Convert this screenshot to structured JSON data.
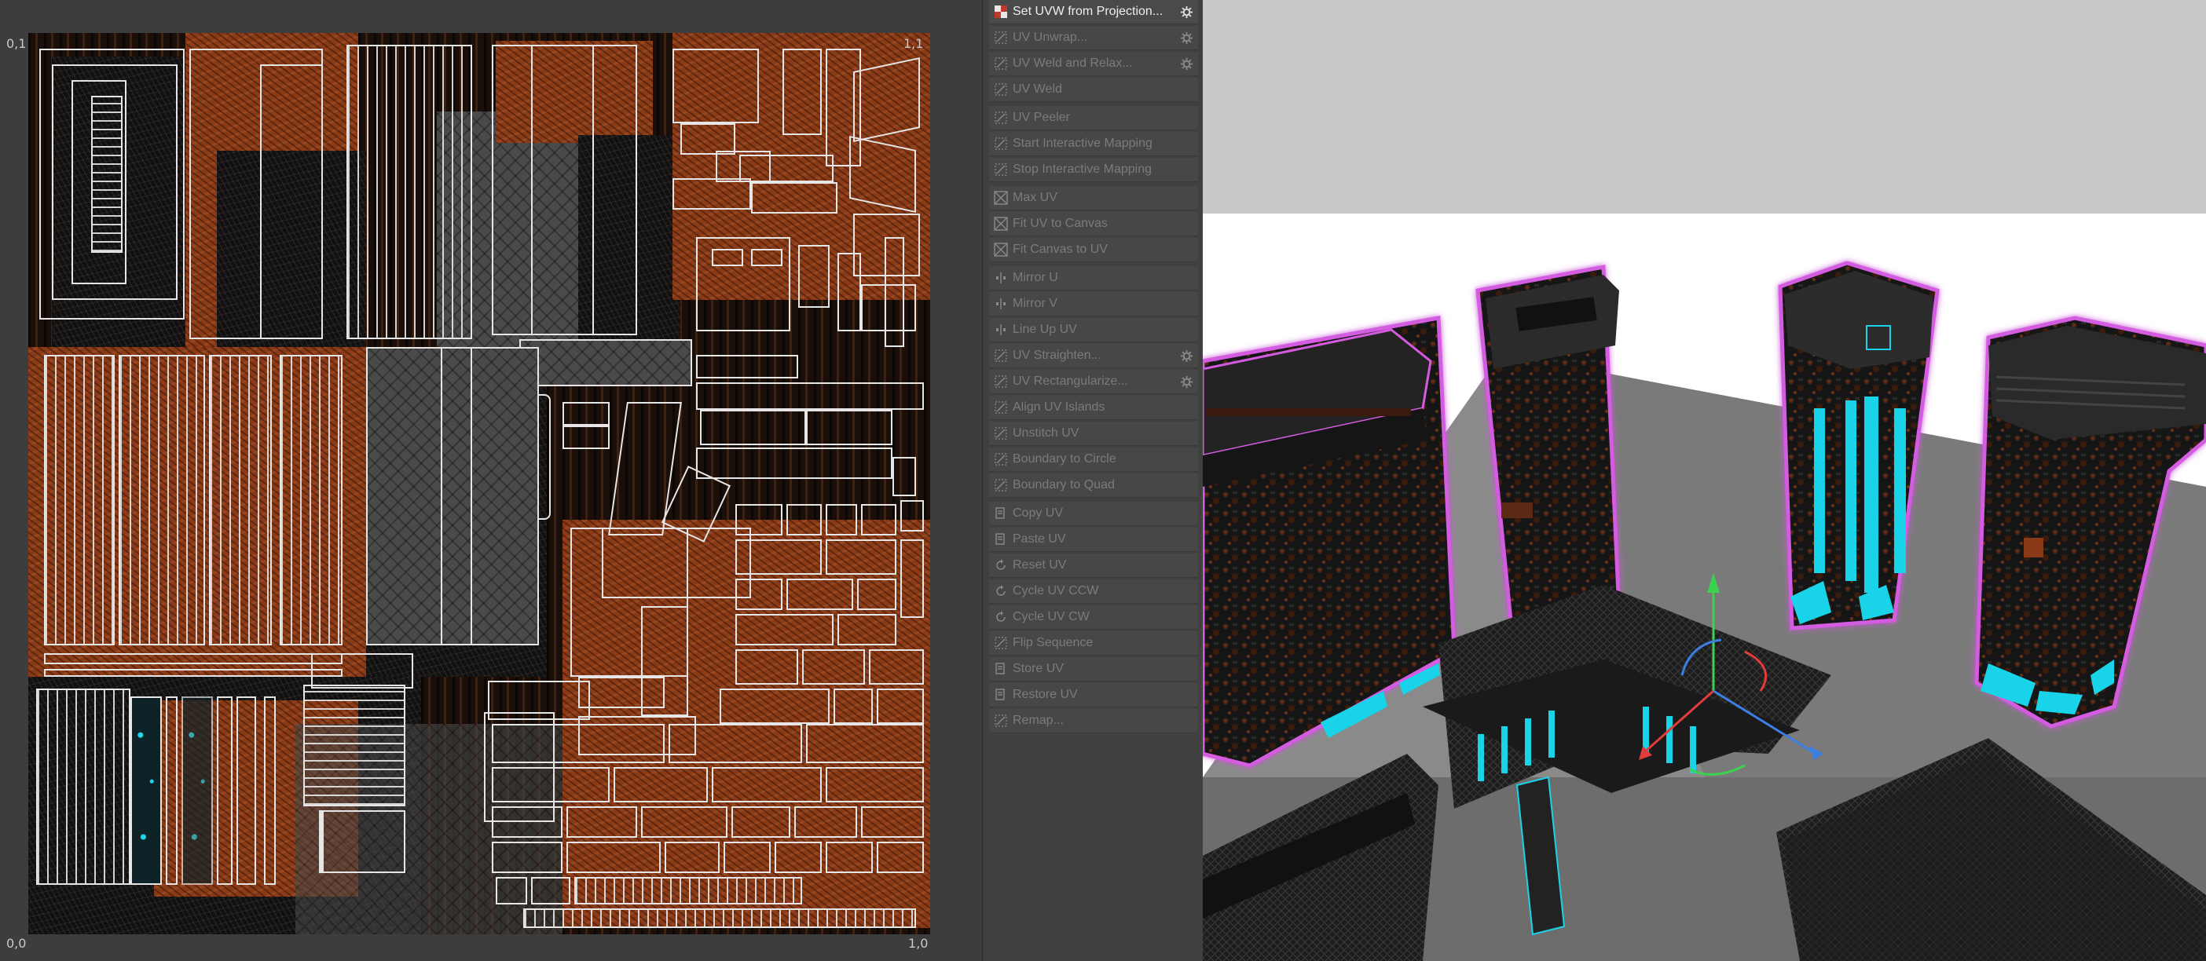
{
  "uv_editor": {
    "coords": {
      "top_left": "0,1",
      "top_right": "1,1",
      "bottom_left": "0,0",
      "bottom_right": "1,0"
    }
  },
  "menu": {
    "items": [
      {
        "label": "Set UVW from Projection...",
        "icon": "checker-icon",
        "active": true,
        "options": true
      },
      {
        "label": "UV Unwrap...",
        "icon": "unwrap-icon",
        "options": true
      },
      {
        "label": "UV Weld and Relax...",
        "icon": "weld-relax-icon",
        "options": true
      },
      {
        "label": "UV Weld",
        "icon": "weld-icon"
      },
      {
        "label": "UV Peeler",
        "icon": "peeler-icon"
      },
      {
        "label": "Start Interactive Mapping",
        "icon": "interactive-map-start-icon"
      },
      {
        "label": "Stop Interactive Mapping",
        "icon": "interactive-map-stop-icon"
      },
      {
        "label": "Max UV",
        "icon": "max-uv-icon"
      },
      {
        "label": "Fit UV to Canvas",
        "icon": "fit-uv-icon"
      },
      {
        "label": "Fit Canvas to UV",
        "icon": "fit-canvas-icon"
      },
      {
        "label": "Mirror U",
        "icon": "mirror-u-icon"
      },
      {
        "label": "Mirror V",
        "icon": "mirror-v-icon"
      },
      {
        "label": "Line Up UV",
        "icon": "line-up-icon"
      },
      {
        "label": "UV Straighten...",
        "icon": "straighten-icon",
        "options": true
      },
      {
        "label": "UV Rectangularize...",
        "icon": "rectangularize-icon",
        "options": true
      },
      {
        "label": "Align UV Islands",
        "icon": "align-islands-icon"
      },
      {
        "label": "Unstitch UV",
        "icon": "unstitch-icon"
      },
      {
        "label": "Boundary to Circle",
        "icon": "boundary-circle-icon"
      },
      {
        "label": "Boundary to Quad",
        "icon": "boundary-quad-icon"
      },
      {
        "label": "Copy UV",
        "icon": "copy-icon"
      },
      {
        "label": "Paste UV",
        "icon": "paste-icon"
      },
      {
        "label": "Reset UV",
        "icon": "reset-icon"
      },
      {
        "label": "Cycle UV CCW",
        "icon": "cycle-ccw-icon"
      },
      {
        "label": "Cycle UV CW",
        "icon": "cycle-cw-icon"
      },
      {
        "label": "Flip Sequence",
        "icon": "flip-sequence-icon"
      },
      {
        "label": "Store UV",
        "icon": "store-icon"
      },
      {
        "label": "Restore UV",
        "icon": "restore-icon"
      },
      {
        "label": "Remap...",
        "icon": "remap-icon"
      }
    ]
  },
  "colors": {
    "accent_active_text": "#eeeeee",
    "disabled_text": "#7b7b7b",
    "rust": "#8b3a17",
    "selection_glow": "#d45be0",
    "emissive_cyan": "#19d4e8",
    "axis_x": "#e23b3b",
    "axis_y": "#3bd24f",
    "axis_z": "#3b7fe2"
  }
}
